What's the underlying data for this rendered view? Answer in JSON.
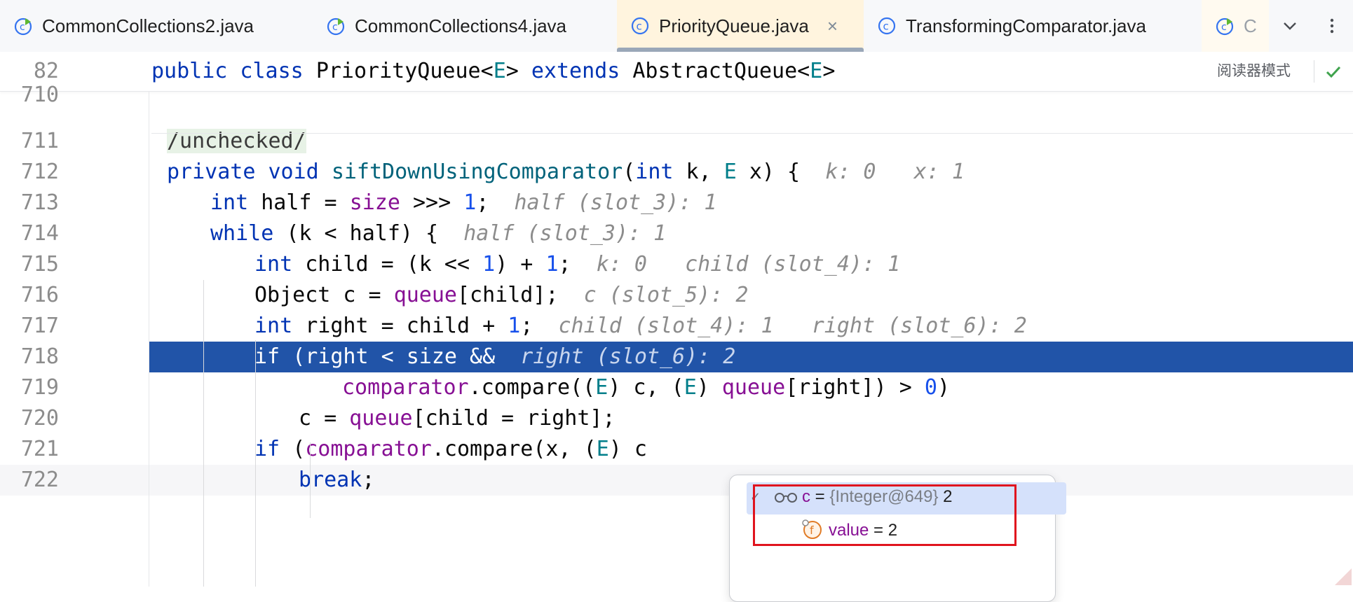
{
  "tabs": [
    {
      "label": "CommonCollections2.java",
      "close": ""
    },
    {
      "label": "CommonCollections4.java",
      "close": ""
    },
    {
      "label": "PriorityQueue.java",
      "close": "×"
    },
    {
      "label": "TransformingComparator.java",
      "close": ""
    },
    {
      "label": "C",
      "close": ""
    }
  ],
  "sticky": {
    "line_number": "82",
    "reader_mode": "阅读器模式",
    "tokens": [
      {
        "t": "public class ",
        "c": "kw"
      },
      {
        "t": "PriorityQueue<",
        "c": ""
      },
      {
        "t": "E",
        "c": "tp"
      },
      {
        "t": "> ",
        "c": ""
      },
      {
        "t": "extends ",
        "c": "kw"
      },
      {
        "t": "AbstractQueue<",
        "c": ""
      },
      {
        "t": "E",
        "c": "tp"
      },
      {
        "t": ">",
        "c": ""
      }
    ]
  },
  "lines": [
    {
      "n": "710",
      "indent": 0,
      "tokens": []
    },
    {
      "n": "711",
      "indent": 1,
      "tokens": [
        {
          "t": "/unchecked/",
          "c": "ann"
        }
      ]
    },
    {
      "n": "712",
      "indent": 1,
      "tokens": [
        {
          "t": "private void ",
          "c": "kw"
        },
        {
          "t": "siftDownUsingComparator",
          "c": "fn"
        },
        {
          "t": "(",
          "c": ""
        },
        {
          "t": "int ",
          "c": "kw"
        },
        {
          "t": "k, ",
          "c": ""
        },
        {
          "t": "E ",
          "c": "tp"
        },
        {
          "t": "x) {  ",
          "c": ""
        },
        {
          "t": "k: 0   x: 1",
          "c": "hint"
        }
      ]
    },
    {
      "n": "713",
      "indent": 2,
      "tokens": [
        {
          "t": "int ",
          "c": "kw"
        },
        {
          "t": "half = ",
          "c": ""
        },
        {
          "t": "size",
          "c": "fld"
        },
        {
          "t": " >>> ",
          "c": ""
        },
        {
          "t": "1",
          "c": "num"
        },
        {
          "t": ";  ",
          "c": ""
        },
        {
          "t": "half (slot_3): 1",
          "c": "hint"
        }
      ]
    },
    {
      "n": "714",
      "indent": 2,
      "tokens": [
        {
          "t": "while ",
          "c": "kw"
        },
        {
          "t": "(k < half) {  ",
          "c": ""
        },
        {
          "t": "half (slot_3): 1",
          "c": "hint"
        }
      ]
    },
    {
      "n": "715",
      "indent": 3,
      "tokens": [
        {
          "t": "int ",
          "c": "kw"
        },
        {
          "t": "child = (k << ",
          "c": ""
        },
        {
          "t": "1",
          "c": "num"
        },
        {
          "t": ") + ",
          "c": ""
        },
        {
          "t": "1",
          "c": "num"
        },
        {
          "t": ";  ",
          "c": ""
        },
        {
          "t": "k: 0   child (slot_4): 1",
          "c": "hint"
        }
      ]
    },
    {
      "n": "716",
      "indent": 3,
      "tokens": [
        {
          "t": "Object c = ",
          "c": ""
        },
        {
          "t": "queue",
          "c": "fld"
        },
        {
          "t": "[child];  ",
          "c": ""
        },
        {
          "t": "c (slot_5): 2",
          "c": "hint"
        }
      ]
    },
    {
      "n": "717",
      "indent": 3,
      "tokens": [
        {
          "t": "int ",
          "c": "kw"
        },
        {
          "t": "right = child + ",
          "c": ""
        },
        {
          "t": "1",
          "c": "num"
        },
        {
          "t": ";  ",
          "c": ""
        },
        {
          "t": "child (slot_4): 1   right (slot_6): 2",
          "c": "hint"
        }
      ]
    },
    {
      "n": "718",
      "indent": 3,
      "highlight": true,
      "tokens": [
        {
          "t": "if ",
          "c": "kw"
        },
        {
          "t": "(right < size &&  ",
          "c": ""
        },
        {
          "t": "right (slot_6): 2",
          "c": "hint"
        }
      ]
    },
    {
      "n": "719",
      "indent": 5,
      "tokens": [
        {
          "t": "comparator",
          "c": "fld"
        },
        {
          "t": ".compare((",
          "c": ""
        },
        {
          "t": "E",
          "c": "tp"
        },
        {
          "t": ") c, (",
          "c": ""
        },
        {
          "t": "E",
          "c": "tp"
        },
        {
          "t": ") ",
          "c": ""
        },
        {
          "t": "queue",
          "c": "fld"
        },
        {
          "t": "[right]) > ",
          "c": ""
        },
        {
          "t": "0",
          "c": "num"
        },
        {
          "t": ")",
          "c": ""
        }
      ]
    },
    {
      "n": "720",
      "indent": 4,
      "tokens": [
        {
          "t": "c = ",
          "c": ""
        },
        {
          "t": "queue",
          "c": "fld"
        },
        {
          "t": "[child = right];",
          "c": ""
        }
      ]
    },
    {
      "n": "721",
      "indent": 3,
      "tokens": [
        {
          "t": "if ",
          "c": "kw"
        },
        {
          "t": "(",
          "c": ""
        },
        {
          "t": "comparator",
          "c": "fld"
        },
        {
          "t": ".compare(x, (",
          "c": ""
        },
        {
          "t": "E",
          "c": "tp"
        },
        {
          "t": ") c",
          "c": ""
        }
      ]
    },
    {
      "n": "722",
      "indent": 4,
      "curline": true,
      "tokens": [
        {
          "t": "break",
          "c": "kw"
        },
        {
          "t": ";",
          "c": ""
        }
      ]
    }
  ],
  "popup": {
    "row1": {
      "name": "c",
      "eq": " = ",
      "ref": "{Integer@649}",
      "value": " 2"
    },
    "row2": {
      "name": "value",
      "eq": " = ",
      "value": "2"
    }
  },
  "colors": {
    "keyword": "#0033b3",
    "method": "#00627a",
    "field": "#871094",
    "number": "#1750eb",
    "type_param": "#007e8a",
    "highlight": "#2154a8",
    "red_box": "#e0141e"
  }
}
